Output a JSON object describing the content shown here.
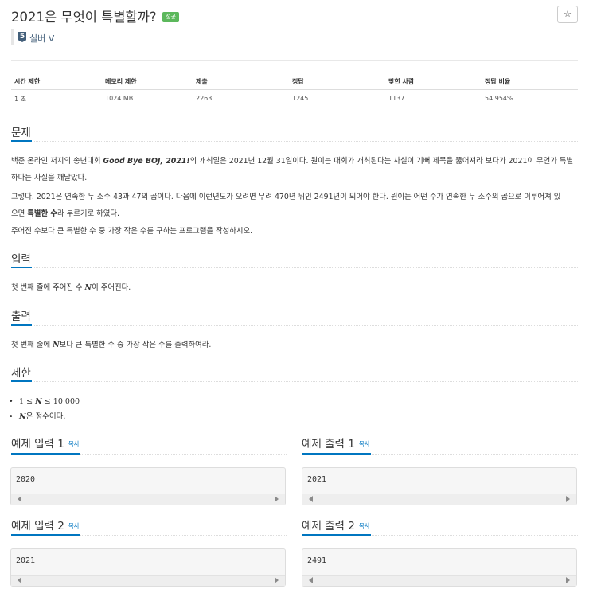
{
  "problem": {
    "title": "2021은 무엇이 특별할까?",
    "status_badge": "성공",
    "star_glyph": "☆",
    "tier": {
      "number": "5",
      "label": "실버 V"
    }
  },
  "info_table": {
    "headers": [
      "시간 제한",
      "메모리 제한",
      "제출",
      "정답",
      "맞힌 사람",
      "정답 비율"
    ],
    "values": [
      "1 초",
      "1024 MB",
      "2263",
      "1245",
      "1137",
      "54.954%"
    ]
  },
  "sections": {
    "description": {
      "title": "문제",
      "p1_a": "백준 온라인 저지의 송년대회 ",
      "p1_bold": "Good Bye BOJ, 2021!",
      "p1_b": "의 개최일은 2021년 12월 31일이다. 원이는 대회가 개최된다는 사실이 기뻐 제목을 뚫어져라 보다가 2021이 무언가 특별",
      "p1_c": "하다는 사실을 깨달았다.",
      "p2_a": "그렇다. 2021은 연속한 두 소수 43과 47의 곱이다. 다음에 이런년도가 오려면 무려 470년 뒤인 2491년이 되어야 한다. 원이는 어떤 수가 연속한 두 소수의 곱으로 이루어져 있",
      "p2_b": "으면 ",
      "p2_bold": "특별한 수",
      "p2_c": "라 부르기로 하였다.",
      "p3": "주어진 수보다 큰 특별한 수 중 가장 작은 수를 구하는 프로그램을 작성하시오."
    },
    "input": {
      "title": "입력",
      "text_a": "첫 번째 줄에 주어진 수 ",
      "var": "N",
      "text_b": "이 주어진다."
    },
    "output": {
      "title": "출력",
      "text_a": "첫 번째 줄에 ",
      "var": "N",
      "text_b": "보다 큰 특별한 수 중 가장 작은 수를 출력하여라."
    },
    "limit": {
      "title": "제한",
      "item1": {
        "lo": "1",
        "op1": "≤",
        "var": "N",
        "op2": "≤",
        "hi": "10 000"
      },
      "item2": {
        "var": "N",
        "text": "은 정수이다."
      }
    }
  },
  "samples": {
    "copy_label": "복사",
    "in1": {
      "title": "예제 입력 1",
      "value": "2020"
    },
    "out1": {
      "title": "예제 출력 1",
      "value": "2021"
    },
    "in2": {
      "title": "예제 입력 2",
      "value": "2021"
    },
    "out2": {
      "title": "예제 출력 2",
      "value": "2491"
    }
  },
  "colors": {
    "accent": "#0076c0",
    "success": "#5cb85c",
    "tier": "#435f7a"
  }
}
